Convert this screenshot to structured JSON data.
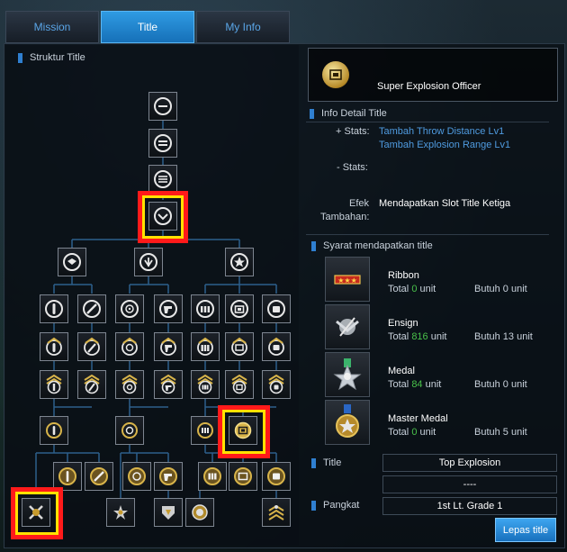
{
  "tabs": [
    {
      "label": "Mission"
    },
    {
      "label": "Title",
      "active": true
    },
    {
      "label": "My Info"
    }
  ],
  "tree": {
    "section_title": "Struktur Title"
  },
  "detail": {
    "selected_title": "Super Explosion Officer",
    "info_header": "Info Detail Title",
    "plus_stats_label": "+ Stats:",
    "plus_stats": [
      "Tambah Throw Distance Lv1",
      "Tambah Explosion Range Lv1"
    ],
    "minus_stats_label": "- Stats:",
    "effect_label_1": "Efek",
    "effect_label_2": "Tambahan:",
    "effect_value": "Mendapatkan Slot Title Ketiga",
    "req_header": "Syarat mendapatkan title",
    "requirements": [
      {
        "name": "Ribbon",
        "total_label": "Total",
        "total": "0",
        "total_unit": "unit",
        "need": "Butuh 0 unit",
        "icon": "ribbon-icon"
      },
      {
        "name": "Ensign",
        "total_label": "Total",
        "total": "816",
        "total_unit": "unit",
        "need": "Butuh 13 unit",
        "icon": "ensign-icon"
      },
      {
        "name": "Medal",
        "total_label": "Total",
        "total": "84",
        "total_unit": "unit",
        "need": "Butuh 0 unit",
        "icon": "medal-icon"
      },
      {
        "name": "Master Medal",
        "total_label": "Total",
        "total": "0",
        "total_unit": "unit",
        "need": "Butuh 5 unit",
        "icon": "master-medal-icon"
      }
    ],
    "title_label": "Title",
    "title_slot_1": "Top Explosion",
    "title_slot_2": "----",
    "rank_label": "Pangkat",
    "rank_value": "1st Lt. Grade 1",
    "release_button": "Lepas title"
  },
  "colors": {
    "accent_blue": "#2f9be3",
    "count_green": "#49c04a",
    "highlight_red": "#ff1a1a",
    "highlight_yellow": "#ffe100"
  }
}
